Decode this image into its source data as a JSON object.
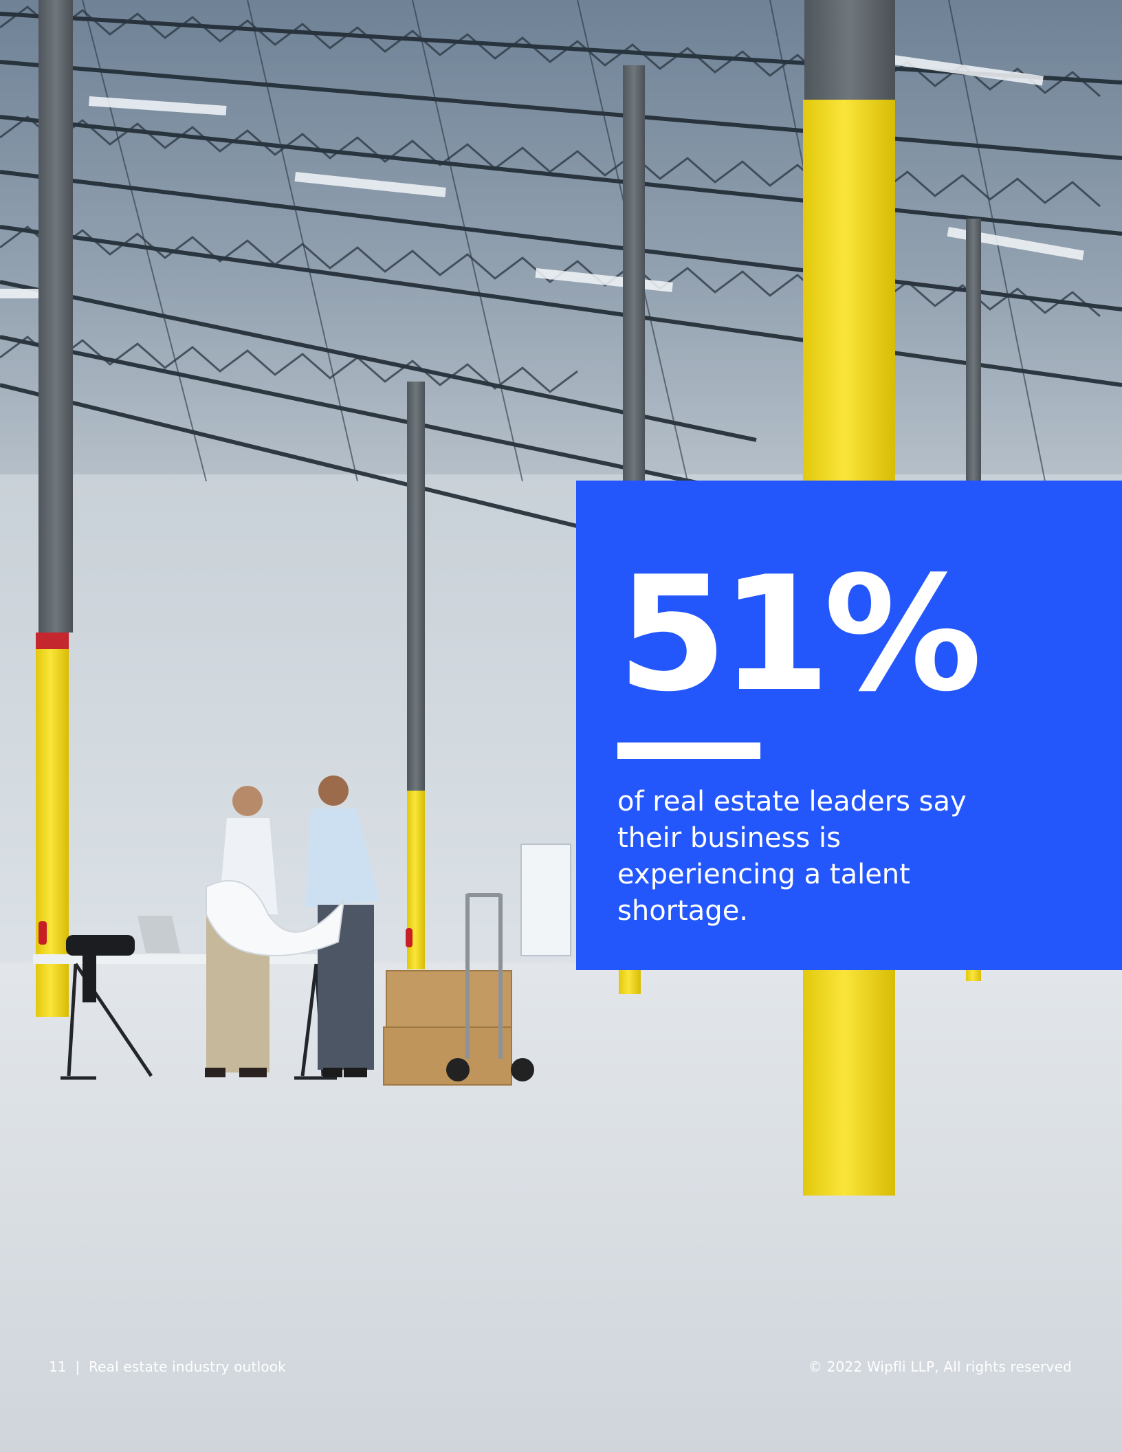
{
  "stat": {
    "value": "51%",
    "caption": "of real estate leaders say their business is experiencing a talent shortage."
  },
  "footer": {
    "page_number": "11",
    "separator": "|",
    "publication": "Real estate industry outlook",
    "copyright": "© 2022 Wipfli LLP, All rights reserved"
  },
  "colors": {
    "panel_blue": "#2457fb",
    "column_yellow": "#f4dd22"
  }
}
